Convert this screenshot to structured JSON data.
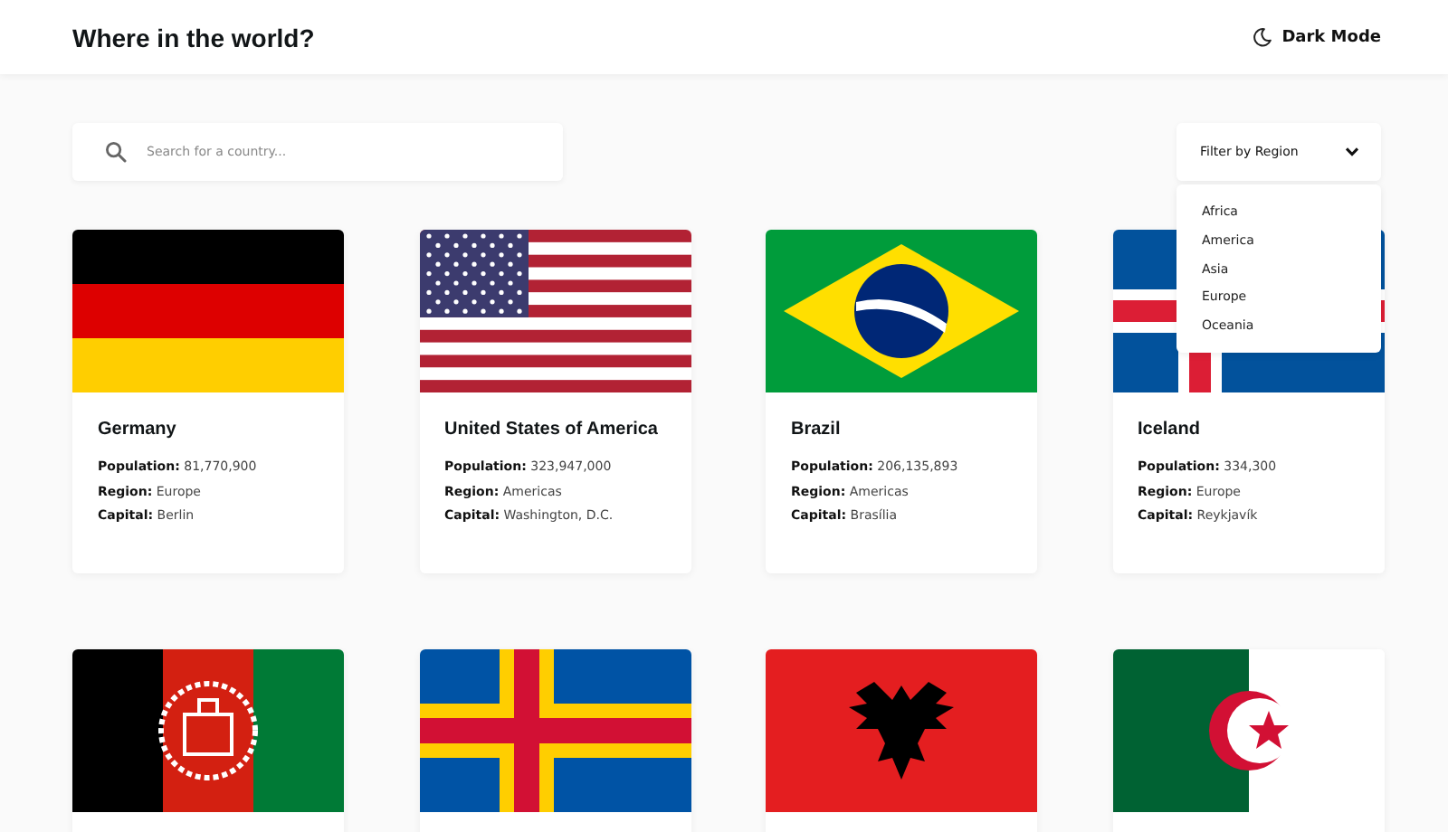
{
  "header": {
    "title": "Where in the world?",
    "theme_toggle": "Dark Mode"
  },
  "search": {
    "placeholder": "Search for a country..."
  },
  "filter": {
    "label": "Filter by Region",
    "expanded": true,
    "options": [
      "Africa",
      "America",
      "Asia",
      "Europe",
      "Oceania"
    ]
  },
  "countries": [
    {
      "kind": "germany",
      "name": "Germany",
      "details": [
        "**Population:** 81,770,900",
        "**Region:** Europe",
        "**Capital:** Berlin"
      ]
    },
    {
      "kind": "usa",
      "name": "United States of America",
      "details": [
        "**Population:** 323,947,000",
        "**Region:** Americas",
        "**Capital:** Washington, D.C."
      ]
    },
    {
      "kind": "brazil",
      "name": "Brazil",
      "details": [
        "**Population:** 206,135,893",
        "**Region:** Americas",
        "**Capital:** Brasília"
      ]
    },
    {
      "kind": "iceland",
      "name": "Iceland",
      "details": [
        "**Population:** 334,300",
        "**Region:** Europe",
        "**Capital:** Reykjavík"
      ]
    },
    {
      "kind": "afghanistan"
    },
    {
      "kind": "aland"
    },
    {
      "kind": "albania"
    },
    {
      "kind": "algeria"
    }
  ]
}
